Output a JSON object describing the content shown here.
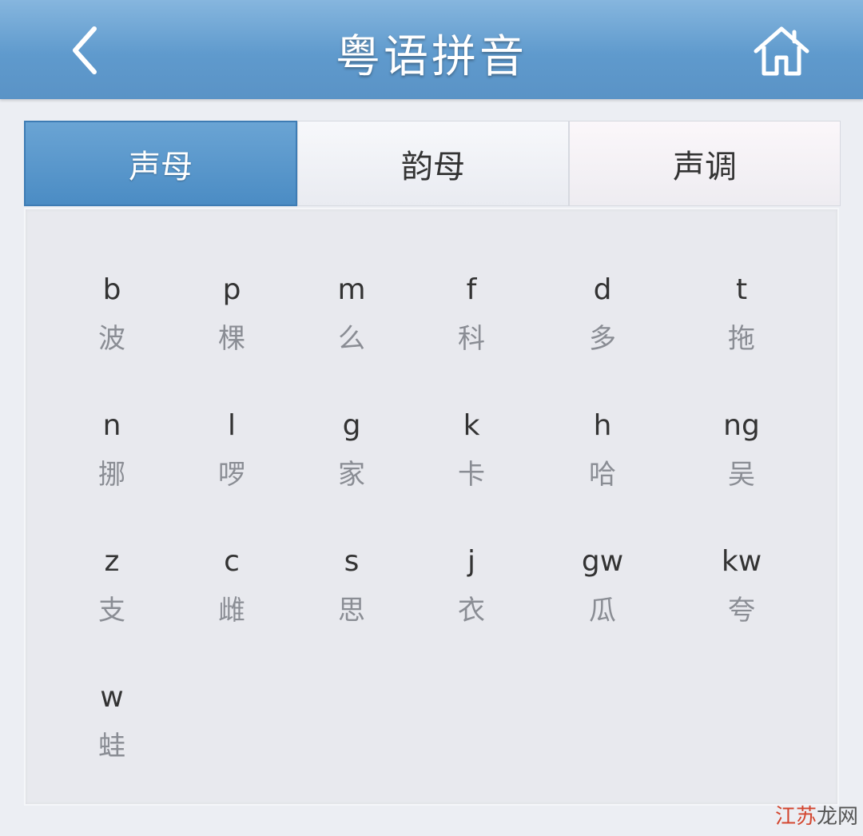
{
  "header": {
    "title": "粤语拼音",
    "back_icon": "chevron-left-icon",
    "home_icon": "home-icon"
  },
  "tabs": [
    {
      "label": "声母",
      "active": true
    },
    {
      "label": "韵母",
      "active": false
    },
    {
      "label": "声调",
      "active": false
    }
  ],
  "initials": [
    {
      "latin": "b",
      "hanzi": "波"
    },
    {
      "latin": "p",
      "hanzi": "棵"
    },
    {
      "latin": "m",
      "hanzi": "么"
    },
    {
      "latin": "f",
      "hanzi": "科"
    },
    {
      "latin": "d",
      "hanzi": "多"
    },
    {
      "latin": "t",
      "hanzi": "拖"
    },
    {
      "latin": "n",
      "hanzi": "挪"
    },
    {
      "latin": "l",
      "hanzi": "啰"
    },
    {
      "latin": "g",
      "hanzi": "家"
    },
    {
      "latin": "k",
      "hanzi": "卡"
    },
    {
      "latin": "h",
      "hanzi": "哈"
    },
    {
      "latin": "ng",
      "hanzi": "吴"
    },
    {
      "latin": "z",
      "hanzi": "支"
    },
    {
      "latin": "c",
      "hanzi": "雌"
    },
    {
      "latin": "s",
      "hanzi": "思"
    },
    {
      "latin": "j",
      "hanzi": "衣"
    },
    {
      "latin": "gw",
      "hanzi": "瓜"
    },
    {
      "latin": "kw",
      "hanzi": "夸"
    },
    {
      "latin": "w",
      "hanzi": "蛙"
    }
  ],
  "watermark": {
    "part1": "江苏",
    "part2": "龙网"
  },
  "colors": {
    "header": "#5f9acd",
    "active_tab": "#4b8cc4",
    "background": "#eceef3"
  }
}
